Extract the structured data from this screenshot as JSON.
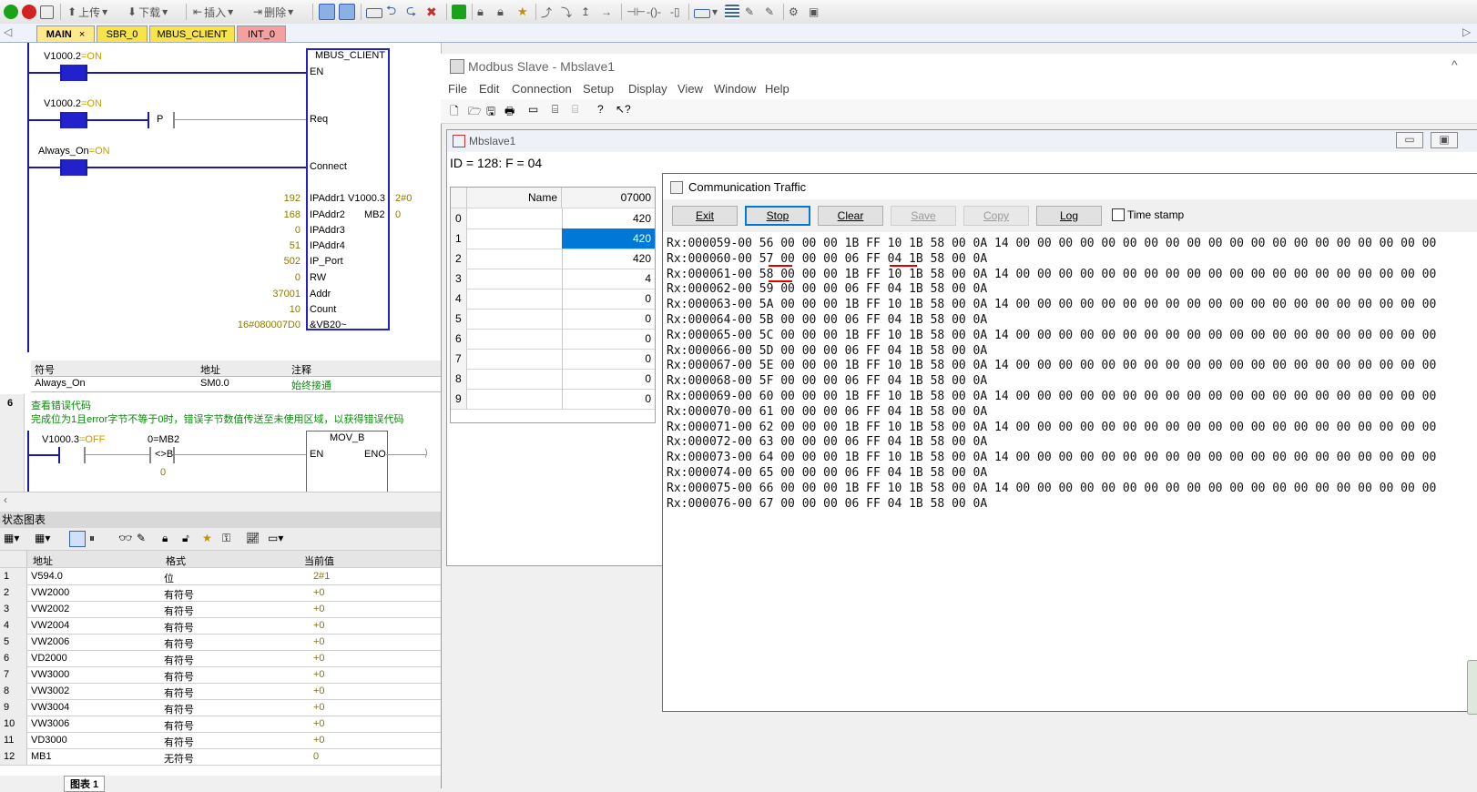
{
  "toolbar": {
    "upload_label": "上传",
    "download_label": "下载",
    "insert_label": "插入",
    "delete_label": "删除"
  },
  "tabs": [
    {
      "label": "MAIN",
      "close": "×"
    },
    {
      "label": "SBR_0"
    },
    {
      "label": "MBUS_CLIENT"
    },
    {
      "label": "INT_0"
    }
  ],
  "ladder": {
    "contact1": "V1000.2",
    "contact1_state": "=ON",
    "contact2": "V1000.2",
    "contact2_state": "=ON",
    "p_label": "P",
    "contact3": "Always_On",
    "contact3_state": "=ON",
    "block_title": "MBUS_CLIENT",
    "pins": {
      "en": "EN",
      "req": "Req",
      "connect": "Connect",
      "ipaddr1": "IPAddr1",
      "ipaddr2": "IPAddr2",
      "ipaddr3": "IPAddr3",
      "ipaddr4": "IPAddr4",
      "ip_port": "IP_Port",
      "rw": "RW",
      "addr": "Addr",
      "count": "Count",
      "data_ptr": "&VB20~"
    },
    "pin_values": {
      "ipaddr1": "192",
      "ipaddr2": "168",
      "ipaddr3": "0",
      "ipaddr4": "51",
      "ip_port": "502",
      "rw": "0",
      "addr": "37001",
      "count": "10",
      "data_ptr": "16#080007D0"
    },
    "outputs": {
      "done_var": "V1000.3",
      "done_val": "2#0",
      "error_var": "MB2",
      "error_val": "0"
    },
    "symbol_table": {
      "headers": [
        "符号",
        "地址",
        "注释"
      ],
      "row": [
        "Always_On",
        "SM0.0",
        "始终接通"
      ]
    },
    "network6": {
      "number": "6",
      "title": "查看错误代码",
      "comment": "完成位为1且error字节不等于0时，错误字节数值传送至未使用区域，以获得错误代码",
      "contact": "V1000.3",
      "contact_state": "=OFF",
      "compare_var": "0=MB2",
      "compare_op": "<>B",
      "compare_val": "0",
      "block_title": "MOV_B",
      "en": "EN",
      "eno": "ENO"
    }
  },
  "status_chart": {
    "title": "状态图表",
    "headers": [
      "地址",
      "格式",
      "当前值"
    ],
    "rows": [
      {
        "n": "1",
        "addr": "V594.0",
        "fmt": "位",
        "val": "2#1"
      },
      {
        "n": "2",
        "addr": "VW2000",
        "fmt": "有符号",
        "val": "+0"
      },
      {
        "n": "3",
        "addr": "VW2002",
        "fmt": "有符号",
        "val": "+0"
      },
      {
        "n": "4",
        "addr": "VW2004",
        "fmt": "有符号",
        "val": "+0"
      },
      {
        "n": "5",
        "addr": "VW2006",
        "fmt": "有符号",
        "val": "+0"
      },
      {
        "n": "6",
        "addr": "VD2000",
        "fmt": "有符号",
        "val": "+0"
      },
      {
        "n": "7",
        "addr": "VW3000",
        "fmt": "有符号",
        "val": "+0"
      },
      {
        "n": "8",
        "addr": "VW3002",
        "fmt": "有符号",
        "val": "+0"
      },
      {
        "n": "9",
        "addr": "VW3004",
        "fmt": "有符号",
        "val": "+0"
      },
      {
        "n": "10",
        "addr": "VW3006",
        "fmt": "有符号",
        "val": "+0"
      },
      {
        "n": "11",
        "addr": "VD3000",
        "fmt": "有符号",
        "val": "+0"
      },
      {
        "n": "12",
        "addr": "MB1",
        "fmt": "无符号",
        "val": "0"
      }
    ],
    "sheet_tab": "图表 1"
  },
  "modbus": {
    "app_title": "Modbus Slave - Mbslave1",
    "menu": [
      "File",
      "Edit",
      "Connection",
      "Setup",
      "Display",
      "View",
      "Window",
      "Help"
    ],
    "child_title": "Mbslave1",
    "status_line": "ID = 128: F = 04",
    "grid": {
      "name_header": "Name",
      "addr_header": "07000",
      "rows": [
        {
          "i": "0",
          "v": "420"
        },
        {
          "i": "1",
          "v": "420"
        },
        {
          "i": "2",
          "v": "420"
        },
        {
          "i": "3",
          "v": "4"
        },
        {
          "i": "4",
          "v": "0"
        },
        {
          "i": "5",
          "v": "0"
        },
        {
          "i": "6",
          "v": "0"
        },
        {
          "i": "7",
          "v": "0"
        },
        {
          "i": "8",
          "v": "0"
        },
        {
          "i": "9",
          "v": "0"
        }
      ]
    }
  },
  "traffic": {
    "title": "Communication Traffic",
    "buttons": {
      "exit": "Exit",
      "stop": "Stop",
      "clear": "Clear",
      "save": "Save",
      "copy": "Copy",
      "log": "Log"
    },
    "timestamp_label": "Time stamp",
    "lines": [
      "Rx:000059-00 56 00 00 00 1B FF 10 1B 58 00 0A 14 00 00 00 00 00 00 00 00 00 00 00 00 00 00 00 00 00 00 00 00",
      "Rx:000060-00 57 00 00 00 06 FF 04 1B 58 00 0A",
      "Rx:000061-00 58 00 00 00 1B FF 10 1B 58 00 0A 14 00 00 00 00 00 00 00 00 00 00 00 00 00 00 00 00 00 00 00 00",
      "Rx:000062-00 59 00 00 00 06 FF 04 1B 58 00 0A",
      "Rx:000063-00 5A 00 00 00 1B FF 10 1B 58 00 0A 14 00 00 00 00 00 00 00 00 00 00 00 00 00 00 00 00 00 00 00 00",
      "Rx:000064-00 5B 00 00 00 06 FF 04 1B 58 00 0A",
      "Rx:000065-00 5C 00 00 00 1B FF 10 1B 58 00 0A 14 00 00 00 00 00 00 00 00 00 00 00 00 00 00 00 00 00 00 00 00",
      "Rx:000066-00 5D 00 00 00 06 FF 04 1B 58 00 0A",
      "Rx:000067-00 5E 00 00 00 1B FF 10 1B 58 00 0A 14 00 00 00 00 00 00 00 00 00 00 00 00 00 00 00 00 00 00 00 00",
      "Rx:000068-00 5F 00 00 00 06 FF 04 1B 58 00 0A",
      "Rx:000069-00 60 00 00 00 1B FF 10 1B 58 00 0A 14 00 00 00 00 00 00 00 00 00 00 00 00 00 00 00 00 00 00 00 00",
      "Rx:000070-00 61 00 00 00 06 FF 04 1B 58 00 0A",
      "Rx:000071-00 62 00 00 00 1B FF 10 1B 58 00 0A 14 00 00 00 00 00 00 00 00 00 00 00 00 00 00 00 00 00 00 00 00",
      "Rx:000072-00 63 00 00 00 06 FF 04 1B 58 00 0A",
      "Rx:000073-00 64 00 00 00 1B FF 10 1B 58 00 0A 14 00 00 00 00 00 00 00 00 00 00 00 00 00 00 00 00 00 00 00 00",
      "Rx:000074-00 65 00 00 00 06 FF 04 1B 58 00 0A",
      "Rx:000075-00 66 00 00 00 1B FF 10 1B 58 00 0A 14 00 00 00 00 00 00 00 00 00 00 00 00 00 00 00 00 00 00 00 00",
      "Rx:000076-00 67 00 00 00 06 FF 04 1B 58 00 0A"
    ]
  },
  "colors": {
    "accent": "#0078d7",
    "ladder_blue": "#2222cc",
    "on_text": "#c0a000",
    "annotation_red": "#e00000"
  }
}
